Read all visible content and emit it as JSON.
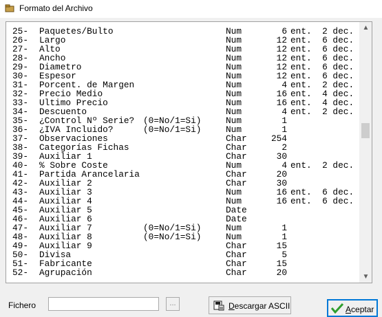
{
  "window": {
    "title": "Formato del Archivo",
    "icon": "folder-box-icon"
  },
  "rows": [
    {
      "num": "25-",
      "name": "Paquetes/Bulto",
      "note": "",
      "type": "Num",
      "len": "6",
      "dec": "ent.  2 dec."
    },
    {
      "num": "26-",
      "name": "Largo",
      "note": "",
      "type": "Num",
      "len": "12",
      "dec": "ent.  6 dec."
    },
    {
      "num": "27-",
      "name": "Alto",
      "note": "",
      "type": "Num",
      "len": "12",
      "dec": "ent.  6 dec."
    },
    {
      "num": "28-",
      "name": "Ancho",
      "note": "",
      "type": "Num",
      "len": "12",
      "dec": "ent.  6 dec."
    },
    {
      "num": "29-",
      "name": "Diametro",
      "note": "",
      "type": "Num",
      "len": "12",
      "dec": "ent.  6 dec."
    },
    {
      "num": "30-",
      "name": "Espesor",
      "note": "",
      "type": "Num",
      "len": "12",
      "dec": "ent.  6 dec."
    },
    {
      "num": "31-",
      "name": "Porcent. de Margen",
      "note": "",
      "type": "Num",
      "len": "4",
      "dec": "ent.  2 dec."
    },
    {
      "num": "32-",
      "name": "Precio Medio",
      "note": "",
      "type": "Num",
      "len": "16",
      "dec": "ent.  4 dec."
    },
    {
      "num": "33-",
      "name": "Ultimo Precio",
      "note": "",
      "type": "Num",
      "len": "16",
      "dec": "ent.  4 dec."
    },
    {
      "num": "34-",
      "name": "Descuento",
      "note": "",
      "type": "Num",
      "len": "4",
      "dec": "ent.  2 dec."
    },
    {
      "num": "35-",
      "name": "¿Control Nº Serie?",
      "note": "(0=No/1=Si)",
      "type": "Num",
      "len": "1",
      "dec": ""
    },
    {
      "num": "36-",
      "name": "¿IVA Incluido?",
      "note": "(0=No/1=Si)",
      "type": "Num",
      "len": "1",
      "dec": ""
    },
    {
      "num": "37-",
      "name": "Observaciones",
      "note": "",
      "type": "Char",
      "len": "254",
      "dec": ""
    },
    {
      "num": "38-",
      "name": "Categorías Fichas",
      "note": "",
      "type": "Char",
      "len": "2",
      "dec": ""
    },
    {
      "num": "39-",
      "name": "Auxiliar 1",
      "note": "",
      "type": "Char",
      "len": "30",
      "dec": ""
    },
    {
      "num": "40-",
      "name": "% Sobre Coste",
      "note": "",
      "type": "Num",
      "len": "4",
      "dec": "ent.  2 dec."
    },
    {
      "num": "41-",
      "name": "Partida Arancelaria",
      "note": "",
      "type": "Char",
      "len": "20",
      "dec": ""
    },
    {
      "num": "42-",
      "name": "Auxiliar 2",
      "note": "",
      "type": "Char",
      "len": "30",
      "dec": ""
    },
    {
      "num": "43-",
      "name": "Auxiliar 3",
      "note": "",
      "type": "Num",
      "len": "16",
      "dec": "ent.  6 dec."
    },
    {
      "num": "44-",
      "name": "Auxiliar 4",
      "note": "",
      "type": "Num",
      "len": "16",
      "dec": "ent.  6 dec."
    },
    {
      "num": "45-",
      "name": "Auxiliar 5",
      "note": "",
      "type": "Date",
      "len": "",
      "dec": ""
    },
    {
      "num": "46-",
      "name": "Auxiliar 6",
      "note": "",
      "type": "Date",
      "len": "",
      "dec": ""
    },
    {
      "num": "47-",
      "name": "Auxiliar 7",
      "note": "(0=No/1=Si)",
      "type": "Num",
      "len": "1",
      "dec": ""
    },
    {
      "num": "48-",
      "name": "Auxiliar 8",
      "note": "(0=No/1=Si)",
      "type": "Num",
      "len": "1",
      "dec": ""
    },
    {
      "num": "49-",
      "name": "Auxiliar 9",
      "note": "",
      "type": "Char",
      "len": "15",
      "dec": ""
    },
    {
      "num": "50-",
      "name": "Divisa",
      "note": "",
      "type": "Char",
      "len": "5",
      "dec": ""
    },
    {
      "num": "51-",
      "name": "Fabricante",
      "note": "",
      "type": "Char",
      "len": "15",
      "dec": ""
    },
    {
      "num": "52-",
      "name": "Agrupación",
      "note": "",
      "type": "Char",
      "len": "20",
      "dec": ""
    }
  ],
  "footer": {
    "fichero_label": "Fichero",
    "fichero_value": "",
    "browse_label": "...",
    "ascii_button": "Descargar ASCII",
    "accept_button": "Aceptar"
  },
  "colors": {
    "accent": "#0078d7",
    "check_green": "#2e9e2e"
  }
}
